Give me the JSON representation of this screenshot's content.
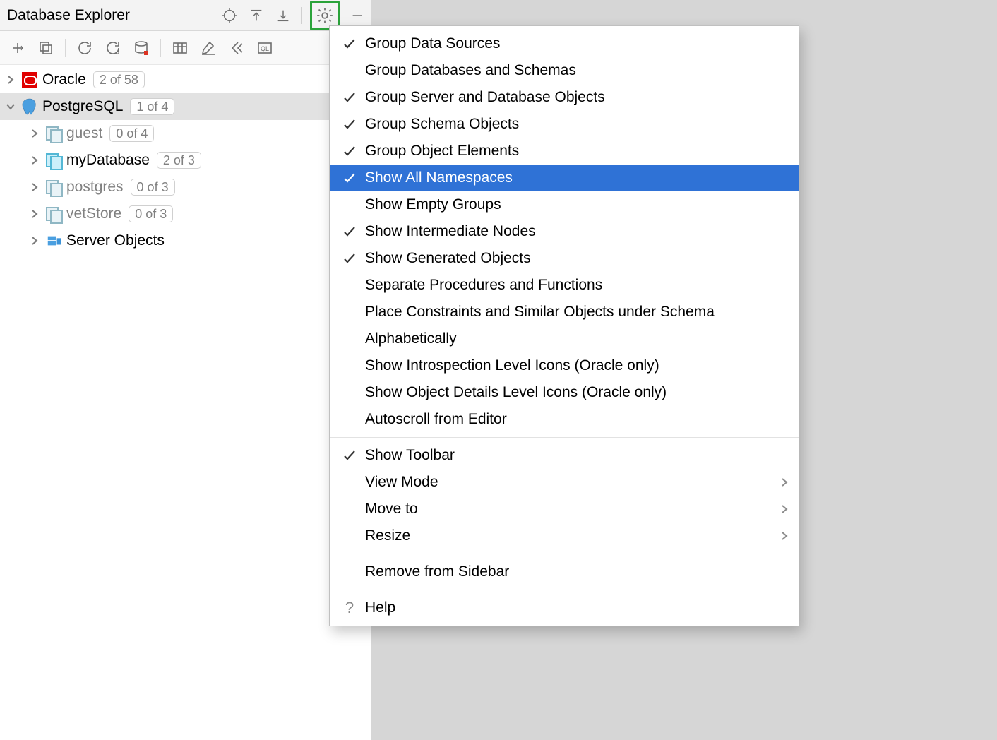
{
  "panel": {
    "title": "Database Explorer"
  },
  "tree": {
    "oracle": {
      "label": "Oracle",
      "badge": "2 of 58"
    },
    "postgres": {
      "label": "PostgreSQL",
      "badge": "1 of 4"
    },
    "guest": {
      "label": "guest",
      "badge": "0 of 4"
    },
    "mydb": {
      "label": "myDatabase",
      "badge": "2 of 3"
    },
    "pg": {
      "label": "postgres",
      "badge": "0 of 3"
    },
    "vet": {
      "label": "vetStore",
      "badge": "0 of 3"
    },
    "server": {
      "label": "Server Objects"
    }
  },
  "menu": {
    "group_ds": "Group Data Sources",
    "group_db": "Group Databases and Schemas",
    "group_srv": "Group Server and Database Objects",
    "group_schema": "Group Schema Objects",
    "group_elem": "Group Object Elements",
    "show_ns": "Show All Namespaces",
    "show_empty": "Show Empty Groups",
    "show_inter": "Show Intermediate Nodes",
    "show_gen": "Show Generated Objects",
    "sep_proc": "Separate Procedures and Functions",
    "place_constr": "Place Constraints and Similar Objects under Schema",
    "alpha": "Alphabetically",
    "show_intro_lvl": "Show Introspection Level Icons (Oracle only)",
    "show_detail_lvl": "Show Object Details Level Icons (Oracle only)",
    "autoscroll": "Autoscroll from Editor",
    "show_toolbar": "Show Toolbar",
    "view_mode": "View Mode",
    "move_to": "Move to",
    "resize": "Resize",
    "remove": "Remove from Sidebar",
    "help": "Help"
  }
}
